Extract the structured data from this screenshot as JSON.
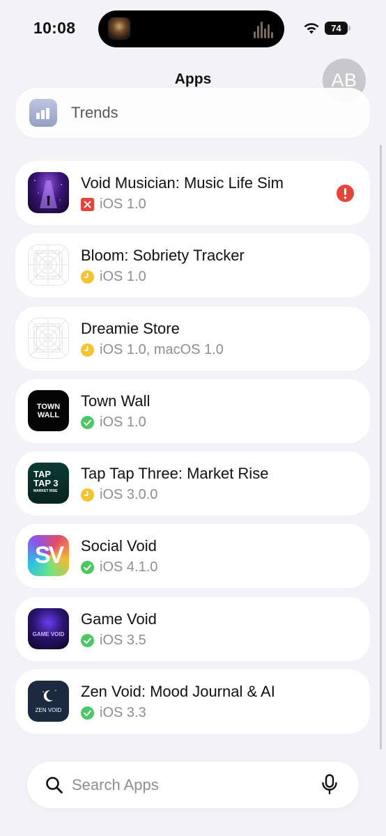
{
  "status_bar": {
    "time": "10:08",
    "battery": "74"
  },
  "header": {
    "title": "Apps",
    "avatar_initials": "AB"
  },
  "trends": {
    "label": "Trends"
  },
  "apps": [
    {
      "name": "Void Musician: Music Life Sim",
      "version": "iOS 1.0",
      "status": "rejected",
      "alert": true
    },
    {
      "name": "Bloom: Sobriety Tracker",
      "version": "iOS 1.0",
      "status": "pending"
    },
    {
      "name": "Dreamie Store",
      "version": "iOS 1.0, macOS 1.0",
      "status": "pending"
    },
    {
      "name": "Town Wall",
      "version": "iOS 1.0",
      "status": "approved"
    },
    {
      "name": "Tap Tap Three: Market Rise",
      "version": "iOS 3.0.0",
      "status": "pending"
    },
    {
      "name": "Social Void",
      "version": "iOS 4.1.0",
      "status": "approved"
    },
    {
      "name": "Game Void",
      "version": "iOS 3.5",
      "status": "approved"
    },
    {
      "name": "Zen Void: Mood Journal & AI",
      "version": "iOS 3.3",
      "status": "approved"
    }
  ],
  "app_icons": {
    "town_wall": "TOWN WALL",
    "tap_tap": "TAP TAP 3",
    "tap_tap_sub": "MARKET RISE",
    "social_void": "SV",
    "game_void": "GAME VOID",
    "zen_void": "ZEN VOID"
  },
  "search": {
    "placeholder": "Search Apps",
    "value": ""
  },
  "colors": {
    "rejected": "#e5443b",
    "pending": "#f4c430",
    "approved": "#4cc764",
    "background": "#f2f2f7"
  }
}
